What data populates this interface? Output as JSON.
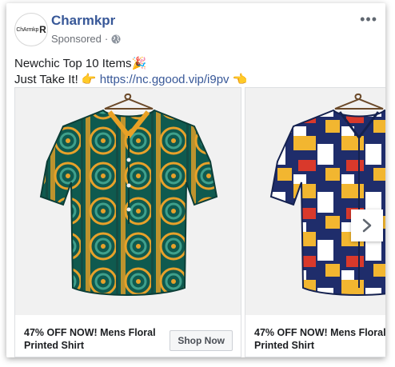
{
  "post": {
    "avatar_text": "ChArmkp",
    "avatar_letter": "R",
    "page_name": "Charmkpr",
    "sponsored": "Sponsored",
    "dot": "·",
    "more": "•••",
    "caption_line1": "Newchic Top 10 Items🎉",
    "caption_line2_prefix": "Just Take It! 👉 ",
    "caption_link": "https://nc.ggood.vip/i9pv",
    "caption_line2_suffix": " 👈"
  },
  "carousel": {
    "items": [
      {
        "title": "47% OFF NOW! Mens Floral Printed Shirt",
        "cta": "Shop Now",
        "image": "green-floral-shirt"
      },
      {
        "title": "47% OFF NOW! Mens Floral Printed Shirt",
        "image": "colorblock-shirt"
      }
    ],
    "next_icon": "chevron-right-icon"
  }
}
